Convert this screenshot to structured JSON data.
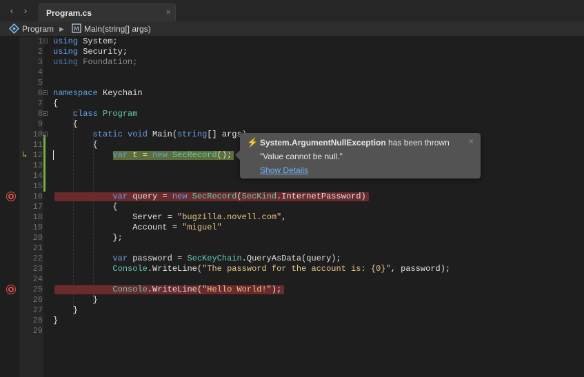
{
  "nav": {
    "back_glyph": "‹",
    "forward_glyph": "›"
  },
  "tab": {
    "title": "Program.cs",
    "close_glyph": "×"
  },
  "breadcrumb": {
    "items": [
      "Program",
      "Main(string[] args)"
    ],
    "separator": "▶"
  },
  "editor": {
    "line_numbers": [
      "1",
      "2",
      "3",
      "4",
      "5",
      "6",
      "7",
      "8",
      "9",
      "10",
      "11",
      "12",
      "13",
      "14",
      "15",
      "16",
      "17",
      "18",
      "19",
      "20",
      "21",
      "22",
      "23",
      "24",
      "25",
      "26",
      "27",
      "28",
      "29"
    ],
    "breakpoint_lines": [
      16,
      25
    ],
    "current_line": 12
  },
  "popup": {
    "icon": "lightning-icon",
    "exception": "System.ArgumentNullException",
    "thrown_suffix": " has been thrown",
    "message": "\"Value cannot be null.\"",
    "link": "Show Details",
    "close_glyph": "×"
  },
  "colors": {
    "keyword": "#66a2e8",
    "type": "#64c8b4",
    "string": "#e9c586",
    "breakpoint": "#e0524f",
    "breakpoint_line": "#6b2b2d",
    "current_line": "#5c6e3a",
    "link": "#6fb1f2"
  }
}
